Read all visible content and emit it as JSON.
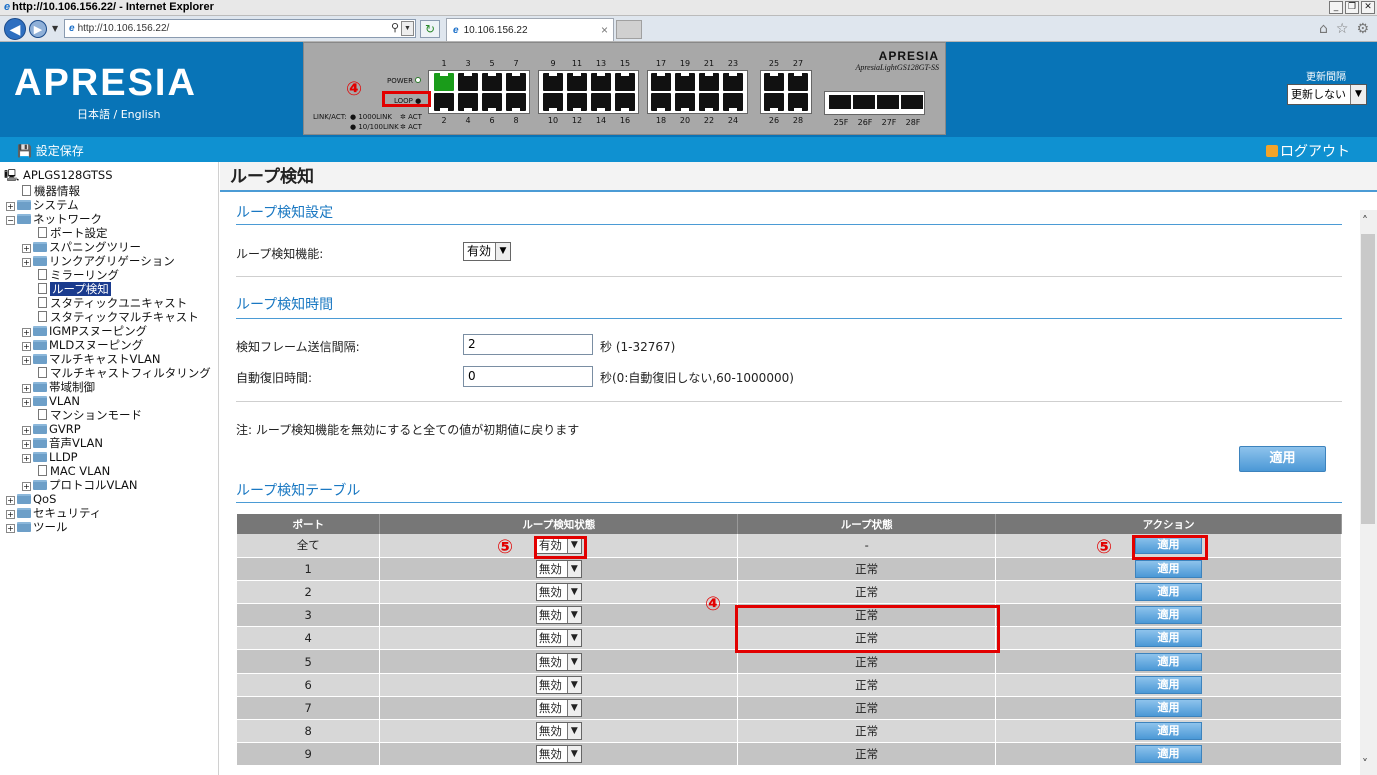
{
  "browser": {
    "window_title": "http://10.106.156.22/ - Internet Explorer",
    "address": "http://10.106.156.22/",
    "tab_title": "10.106.156.22"
  },
  "header": {
    "logo": "APRESIA",
    "lang": "日本語 / English",
    "brand": "APRESIA",
    "model": "ApresiaLightGS128GT-SS",
    "power_label": "POWER",
    "loop_label": "LOOP",
    "linkact_label": "LINK/ACT:",
    "link_1000": "1000LINK",
    "link_100": "10/100LINK",
    "act": "ACT",
    "top_ports": [
      "1",
      "3",
      "5",
      "7",
      "9",
      "11",
      "13",
      "15",
      "17",
      "19",
      "21",
      "23",
      "25",
      "27"
    ],
    "bottom_ports": [
      "2",
      "4",
      "6",
      "8",
      "10",
      "12",
      "14",
      "16",
      "18",
      "20",
      "22",
      "24",
      "26",
      "28"
    ],
    "sfp_ports": [
      "25F",
      "26F",
      "27F",
      "28F"
    ],
    "refresh_label": "更新間隔",
    "refresh_value": "更新しない"
  },
  "toolbar": {
    "save": "設定保存",
    "logout": "ログアウト"
  },
  "tree": {
    "root": "APLGS128GTSS",
    "items": [
      {
        "label": "機器情報"
      },
      {
        "label": "システム"
      },
      {
        "label": "ネットワーク"
      },
      {
        "label": "ポート設定"
      },
      {
        "label": "スパニングツリー"
      },
      {
        "label": "リンクアグリゲーション"
      },
      {
        "label": "ミラーリング"
      },
      {
        "label": "ループ検知"
      },
      {
        "label": "スタティックユニキャスト"
      },
      {
        "label": "スタティックマルチキャスト"
      },
      {
        "label": "IGMPスヌーピング"
      },
      {
        "label": "MLDスヌーピング"
      },
      {
        "label": "マルチキャストVLAN"
      },
      {
        "label": "マルチキャストフィルタリング"
      },
      {
        "label": "帯域制御"
      },
      {
        "label": "VLAN"
      },
      {
        "label": "マンションモード"
      },
      {
        "label": "GVRP"
      },
      {
        "label": "音声VLAN"
      },
      {
        "label": "LLDP"
      },
      {
        "label": "MAC VLAN"
      },
      {
        "label": "プロトコルVLAN"
      },
      {
        "label": "QoS"
      },
      {
        "label": "セキュリティ"
      },
      {
        "label": "ツール"
      }
    ]
  },
  "main": {
    "title": "ループ検知",
    "section1": "ループ検知設定",
    "func_label": "ループ検知機能:",
    "func_value": "有効",
    "section2": "ループ検知時間",
    "interval_label": "検知フレーム送信間隔:",
    "interval_value": "2",
    "interval_hint": "秒 (1-32767)",
    "recover_label": "自動復旧時間:",
    "recover_value": "0",
    "recover_hint": "秒(0:自動復旧しない,60-1000000)",
    "note": "注: ループ検知機能を無効にすると全ての値が初期値に戻ります",
    "apply": "適用",
    "section3": "ループ検知テーブル",
    "table": {
      "headers": [
        "ポート",
        "ループ検知状態",
        "ループ状態",
        "アクション"
      ],
      "rows": [
        {
          "port": "全て",
          "detect": "有効",
          "status": "-",
          "action": "適用"
        },
        {
          "port": "1",
          "detect": "無効",
          "status": "正常",
          "action": "適用"
        },
        {
          "port": "2",
          "detect": "無効",
          "status": "正常",
          "action": "適用"
        },
        {
          "port": "3",
          "detect": "無効",
          "status": "正常",
          "action": "適用"
        },
        {
          "port": "4",
          "detect": "無効",
          "status": "正常",
          "action": "適用"
        },
        {
          "port": "5",
          "detect": "無効",
          "status": "正常",
          "action": "適用"
        },
        {
          "port": "6",
          "detect": "無効",
          "status": "正常",
          "action": "適用"
        },
        {
          "port": "7",
          "detect": "無効",
          "status": "正常",
          "action": "適用"
        },
        {
          "port": "8",
          "detect": "無効",
          "status": "正常",
          "action": "適用"
        },
        {
          "port": "9",
          "detect": "無効",
          "status": "正常",
          "action": "適用"
        }
      ]
    }
  },
  "annotations": {
    "four": "④",
    "five": "⑤"
  },
  "colors": {
    "header_blue": "#0874b7",
    "toolbar_blue": "#0f91d1",
    "annotation_red": "#e20000",
    "section_blue": "#1a78c2"
  }
}
